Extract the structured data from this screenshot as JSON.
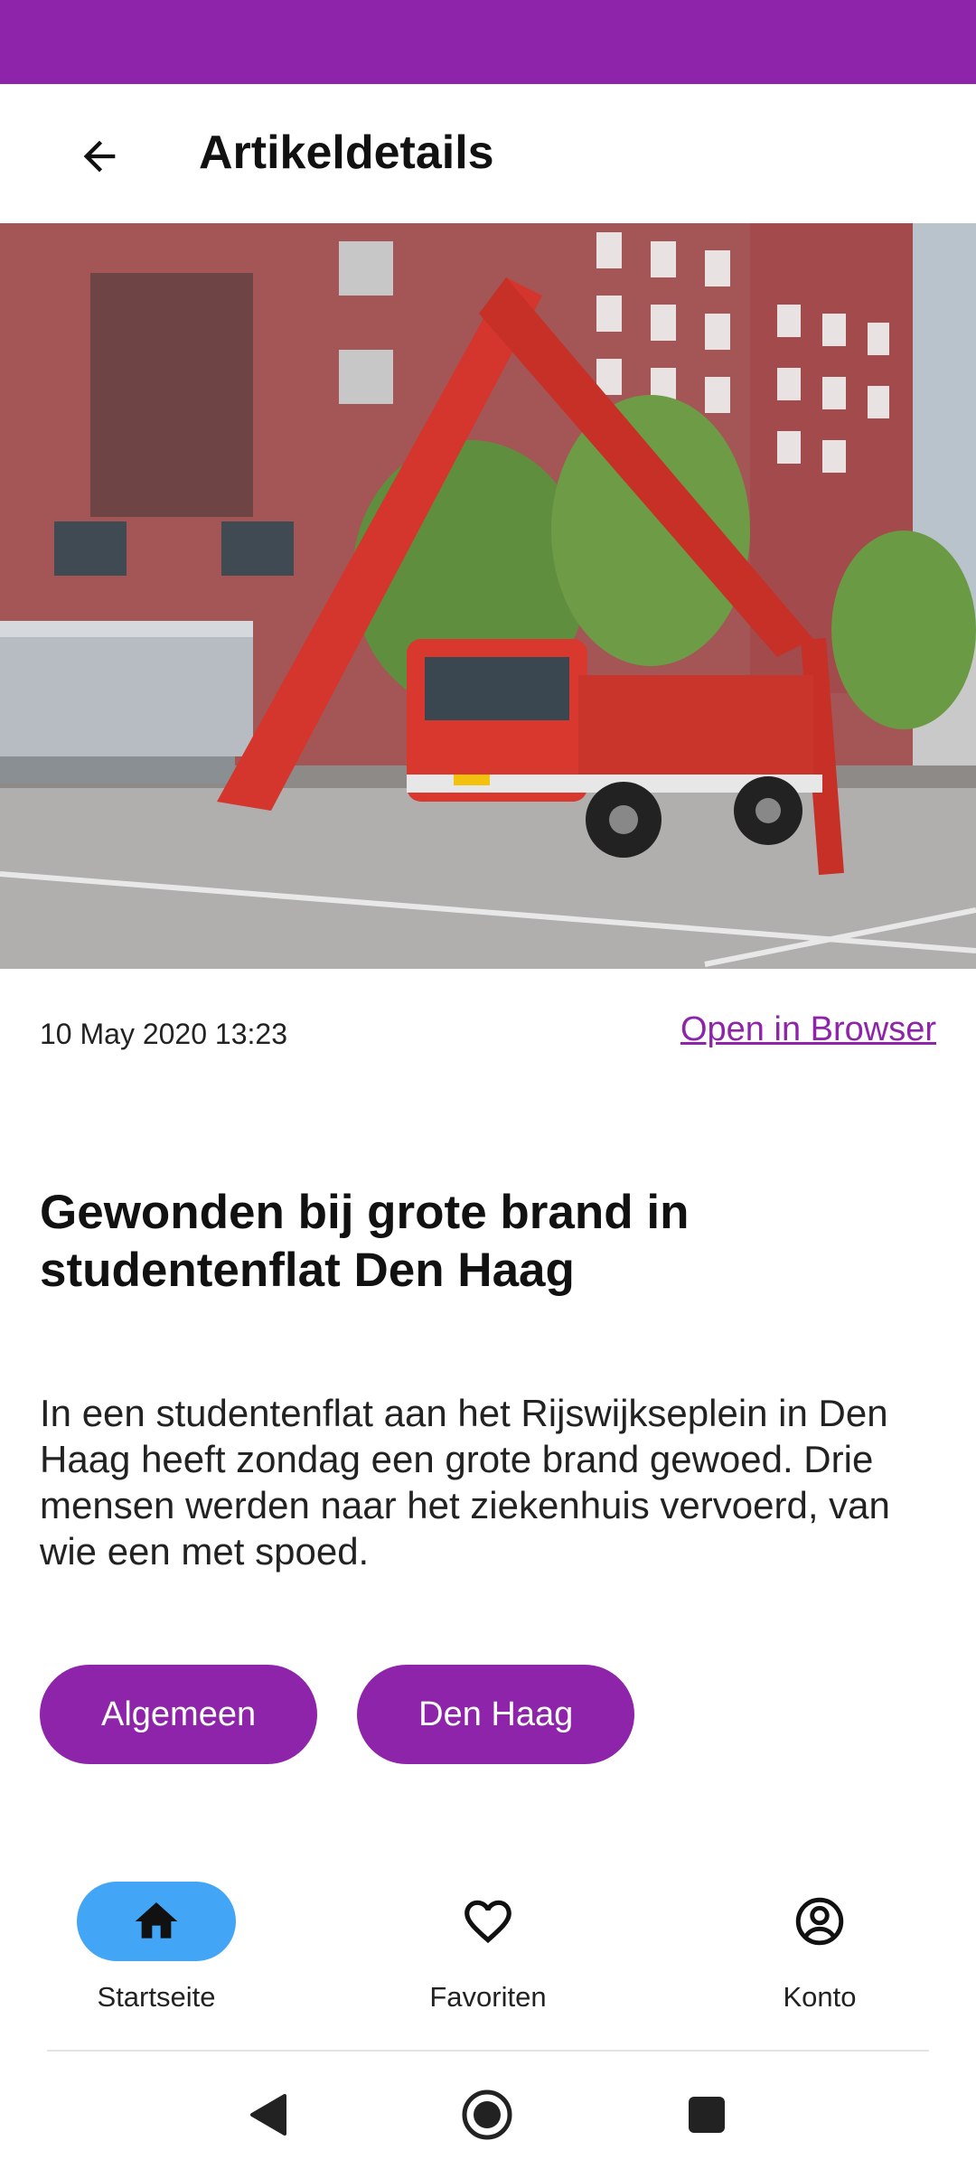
{
  "app_bar": {
    "title": "Artikeldetails"
  },
  "article": {
    "date": "10 May 2020 13:23",
    "open_link": "Open in Browser",
    "headline": "Gewonden bij grote brand in studentenflat Den Haag",
    "summary": "In een studentenflat aan het Rijswijkseplein in Den Haag heeft zondag een grote brand gewoed. Drie mensen werden naar het ziekenhuis vervoerd, van wie een met spoed."
  },
  "tags": [
    "Algemeen",
    "Den Haag"
  ],
  "bottom_nav": [
    {
      "label": "Startseite",
      "icon": "home-icon",
      "active": true
    },
    {
      "label": "Favoriten",
      "icon": "heart-icon",
      "active": false
    },
    {
      "label": "Konto",
      "icon": "account-icon",
      "active": false
    }
  ],
  "colors": {
    "accent": "#8e24aa",
    "nav_active": "#42a5f5"
  }
}
